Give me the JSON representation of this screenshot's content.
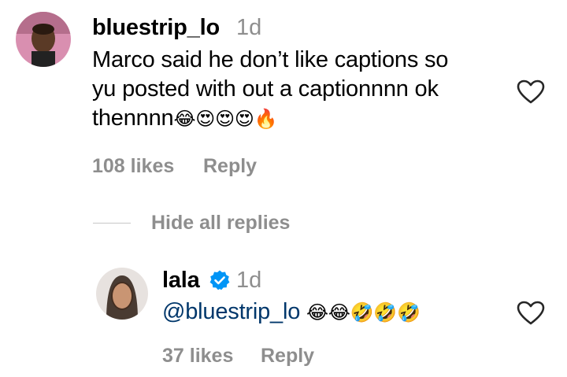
{
  "comment": {
    "username": "bluestrip_lo",
    "time": "1d",
    "text_line1": "Marco said he don’t like captions so",
    "text_line2": "yu posted with out a captionnnn ok",
    "text_line3": "thennnn",
    "emojis": "😂😍😍😍🔥",
    "likes": "108 likes",
    "reply": "Reply",
    "avatar_icon": "user-avatar-photo"
  },
  "replies_toggle": {
    "label": "Hide all replies"
  },
  "reply": {
    "username": "lala",
    "time": "1d",
    "mention": "@bluestrip_lo",
    "emojis": "😂😂🤣🤣🤣",
    "likes": "37 likes",
    "reply": "Reply",
    "verified_icon": "verified-badge-icon",
    "avatar_icon": "user-avatar-photo"
  },
  "colors": {
    "secondary_text": "#8e8e8e",
    "mention": "#00376b",
    "verified": "#0095f6"
  }
}
